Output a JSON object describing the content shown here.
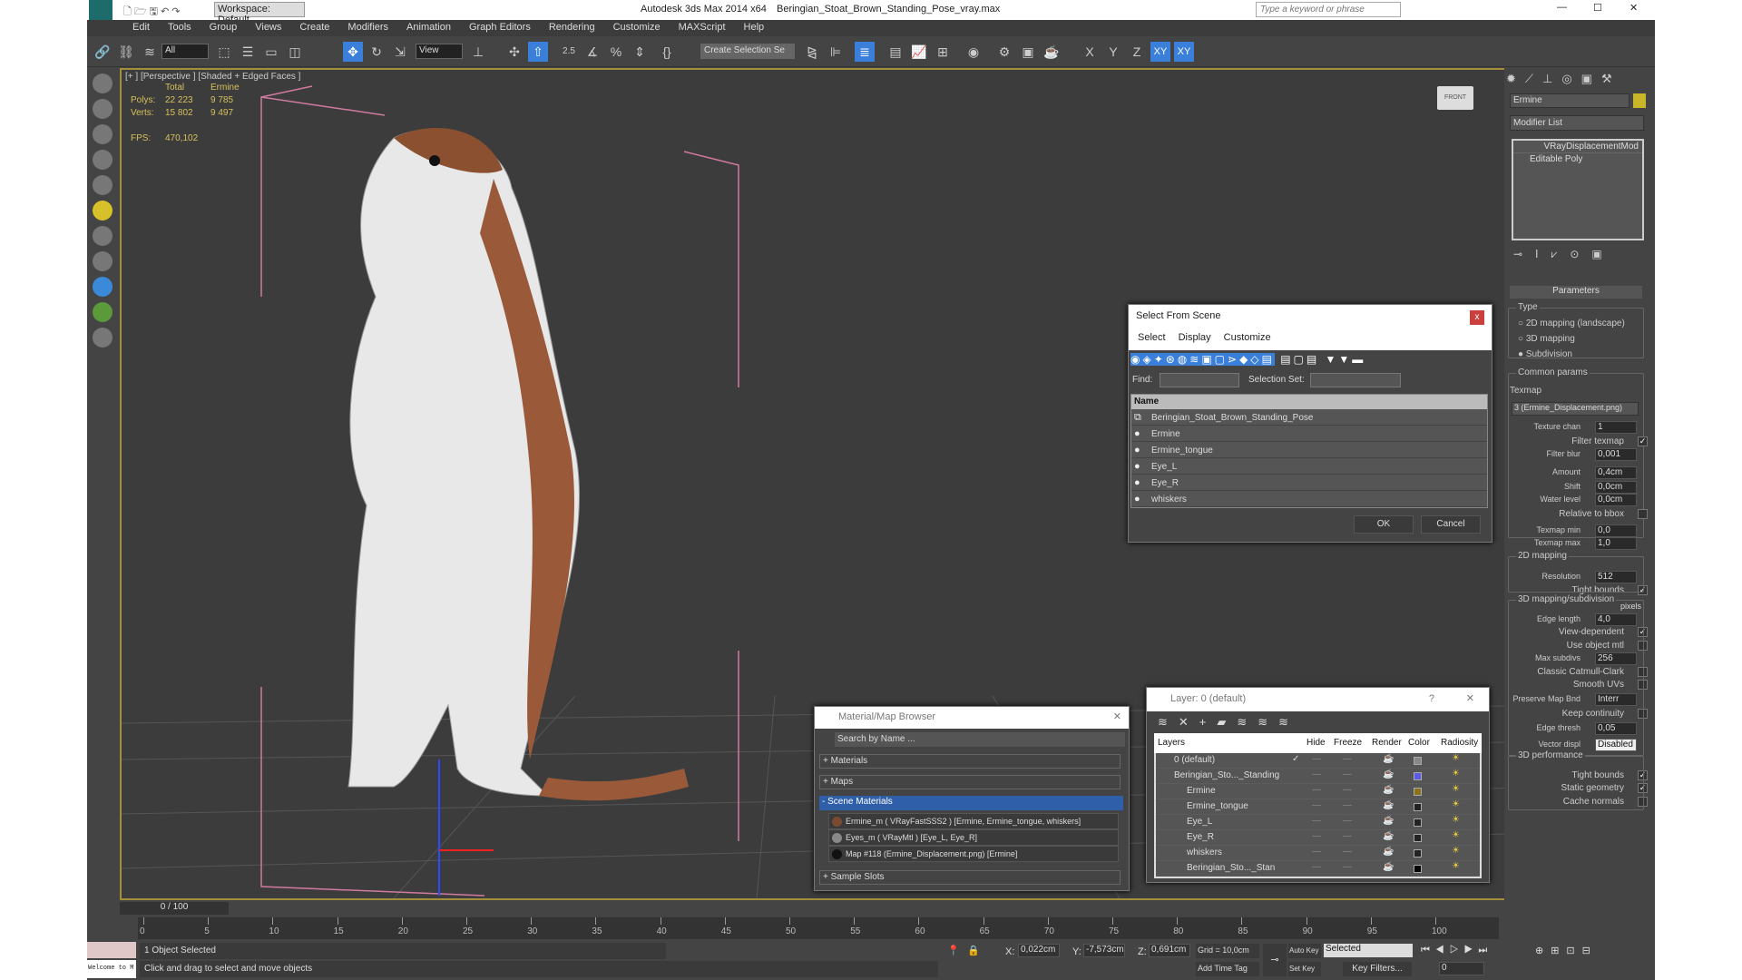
{
  "titlebar": {
    "workspace": "Workspace: Default",
    "app": "Autodesk 3ds Max  2014 x64",
    "file": "Beringian_Stoat_Brown_Standing_Pose_vray.max",
    "search_placeholder": "Type a keyword or phrase"
  },
  "menu": [
    "Edit",
    "Tools",
    "Group",
    "Views",
    "Create",
    "Modifiers",
    "Animation",
    "Graph Editors",
    "Rendering",
    "Customize",
    "MAXScript",
    "Help"
  ],
  "toolbar": {
    "filter": "All",
    "refcoord": "View",
    "selset": "Create Selection Se",
    "snap": "2.5",
    "axes": [
      "X",
      "Y",
      "Z",
      "XY",
      "XY"
    ]
  },
  "viewport": {
    "label": "[+ ] [Perspective ] [Shaded + Edged Faces ]",
    "stats": {
      "col_total": "Total",
      "col_obj": "Ermine",
      "polys_label": "Polys:",
      "polys_total": "22 223",
      "polys_obj": "9 785",
      "verts_label": "Verts:",
      "verts_total": "15 802",
      "verts_obj": "9 497",
      "fps_label": "FPS:",
      "fps": "470,102"
    },
    "viewcube": "FRONT"
  },
  "select_dialog": {
    "title": "Select From Scene",
    "menu": [
      "Select",
      "Display",
      "Customize"
    ],
    "find_label": "Find:",
    "selset_label": "Selection Set:",
    "col_name": "Name",
    "items": [
      "Beringian_Stoat_Brown_Standing_Pose",
      "Ermine",
      "Ermine_tongue",
      "Eye_L",
      "Eye_R",
      "whiskers"
    ],
    "ok": "OK",
    "cancel": "Cancel"
  },
  "material_browser": {
    "title": "Material/Map Browser",
    "search_placeholder": "Search by Name ...",
    "sections": {
      "materials": "+ Materials",
      "maps": "+ Maps",
      "scene": "- Scene Materials",
      "samples": "+ Sample Slots"
    },
    "items": [
      "Ermine_m  ( VRayFastSSS2 )  [Ermine, Ermine_tongue, whiskers]",
      "Eyes_m  ( VRayMtl )  [Eye_L, Eye_R]",
      "Map #118 (Ermine_Displacement.png)  [Ermine]"
    ]
  },
  "layer_dialog": {
    "title": "Layer: 0 (default)",
    "help": "?",
    "columns": [
      "Layers",
      "Hide",
      "Freeze",
      "Render",
      "Color",
      "Radiosity"
    ],
    "rows": [
      {
        "name": "0 (default)",
        "color": "#888888"
      },
      {
        "name": "Beringian_Sto..._Standing",
        "color": "#5a5ae6"
      },
      {
        "name": "Ermine",
        "color": "#8a7318"
      },
      {
        "name": "Ermine_tongue",
        "color": "#222222"
      },
      {
        "name": "Eye_L",
        "color": "#222222"
      },
      {
        "name": "Eye_R",
        "color": "#222222"
      },
      {
        "name": "whiskers",
        "color": "#222222"
      },
      {
        "name": "Beringian_Sto..._Stan",
        "color": "#000000"
      }
    ]
  },
  "command_panel": {
    "object_name": "Ermine",
    "object_color": "#c8b52a",
    "modifier_list": "Modifier List",
    "stack": [
      "VRayDisplacementMod",
      "Editable Poly"
    ],
    "rollout": "Parameters",
    "type_label": "Type",
    "type_options": [
      "2D mapping (landscape)",
      "3D mapping",
      "Subdivision"
    ],
    "type_selected": "Subdivision",
    "common_label": "Common params",
    "texmap_label": "Texmap",
    "texmap": "3 (Ermine_Displacement.png)",
    "texture_chan_label": "Texture chan",
    "texture_chan": "1",
    "filter_texmap_label": "Filter texmap",
    "filter_blur_label": "Filter blur",
    "filter_blur": "0,001",
    "amount_label": "Amount",
    "amount": "0,4cm",
    "shift_label": "Shift",
    "shift": "0,0cm",
    "water_label": "Water level",
    "water": "0,0cm",
    "relbbox_label": "Relative to bbox",
    "texmin_label": "Texmap min",
    "texmin": "0,0",
    "texmax_label": "Texmap max",
    "texmax": "1,0",
    "map2d_label": "2D mapping",
    "resolution_label": "Resolution",
    "resolution": "512",
    "tight_label": "Tight bounds",
    "map3d_label": "3D mapping/subdivision",
    "edge_label": "Edge length",
    "edge": "4,0",
    "pixels": "pixels",
    "viewdep_label": "View-dependent",
    "useobj_label": "Use object mtl",
    "maxsub_label": "Max subdivs",
    "maxsub": "256",
    "catmull_label": "Classic Catmull-Clark",
    "smooth_label": "Smooth UVs",
    "preserve_label": "Preserve Map Bnd",
    "preserve": "Interr",
    "keep_label": "Keep continuity",
    "thresh_label": "Edge thresh",
    "thresh": "0,05",
    "vector_label": "Vector displ",
    "vector": "Disabled",
    "perf_label": "3D performance",
    "tight2_label": "Tight bounds",
    "static_label": "Static geometry",
    "cache_label": "Cache normals"
  },
  "timeline": {
    "frame": "0 / 100",
    "ticks": [
      "0",
      "5",
      "10",
      "15",
      "20",
      "25",
      "30",
      "35",
      "40",
      "45",
      "50",
      "55",
      "60",
      "65",
      "70",
      "75",
      "80",
      "85",
      "90",
      "95",
      "100"
    ]
  },
  "status": {
    "welcome": "Welcome to M",
    "selected": "1 Object Selected",
    "prompt": "Click and drag to select and move objects",
    "x_label": "X:",
    "x": "0,022cm",
    "y_label": "Y:",
    "y": "-7,573cm",
    "z_label": "Z:",
    "z": "0,691cm",
    "grid": "Grid = 10,0cm",
    "add_time_tag": "Add Time Tag",
    "auto_key": "Auto Key",
    "set_key": "Set Key",
    "key_mode": "Selected",
    "key_filters": "Key Filters...",
    "current_frame": "0"
  }
}
